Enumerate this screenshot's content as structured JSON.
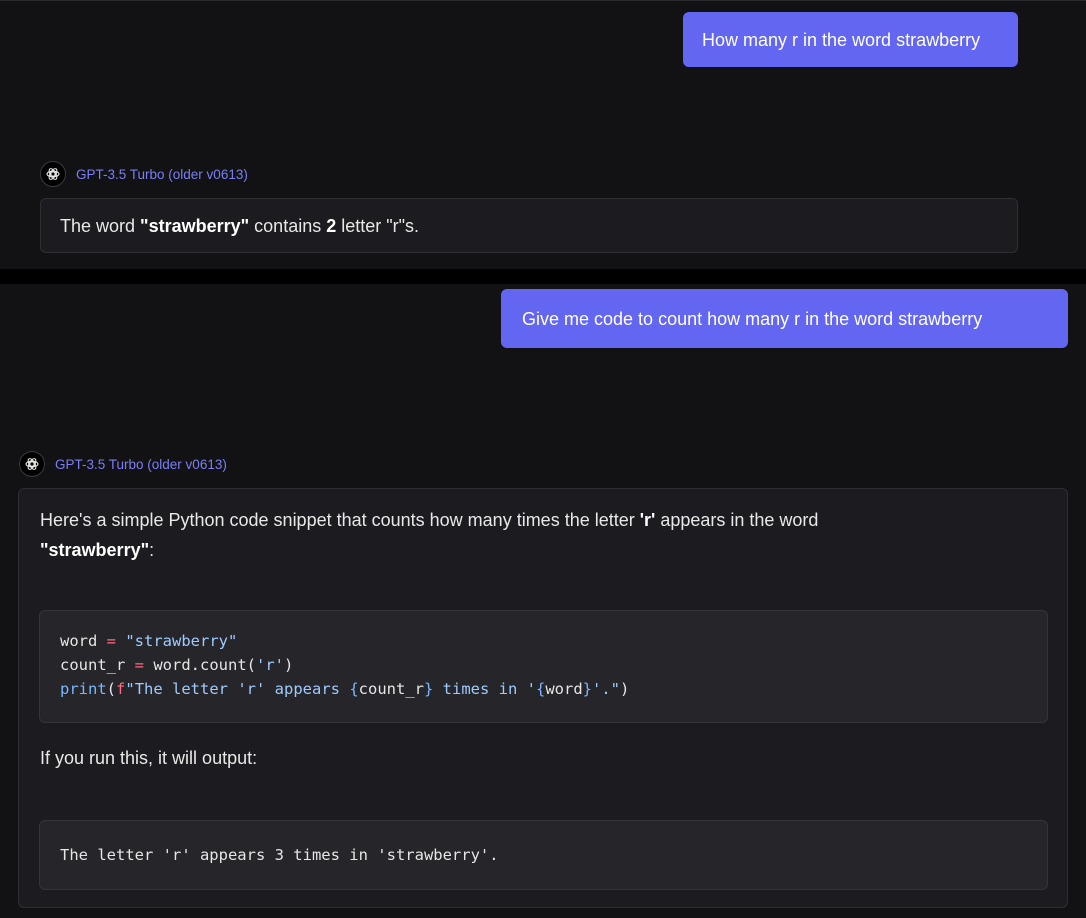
{
  "conversation_1": {
    "user_message": "How many r in the word strawberry",
    "model_name": "GPT-3.5 Turbo (older v0613)",
    "model_icon": "openai-logo-icon",
    "answer": {
      "part1": "The word ",
      "word": "\"strawberry\"",
      "part2": " contains ",
      "count": "2",
      "part3": " letter \"r\"s."
    }
  },
  "conversation_2": {
    "user_message": "Give me code to count how many r in the word strawberry",
    "model_name": "GPT-3.5 Turbo (older v0613)",
    "model_icon": "openai-logo-icon",
    "intro": {
      "part1": "Here's a simple Python code snippet that counts how many times the letter ",
      "letter": "'r'",
      "part2": " appears in the word",
      "word": "\"strawberry\"",
      "part3": ":"
    },
    "code": {
      "l1_var": "word",
      "l1_op": " = ",
      "l1_str": "\"strawberry\"",
      "l2_var": "count_r",
      "l2_op": " = ",
      "l2_call": "word.count(",
      "l2_str": "'r'",
      "l2_close": ")",
      "l3_fn": "print",
      "l3_open": "(",
      "l3_prefix": "f",
      "l3_str1": "\"The letter 'r' appears ",
      "l3_brace1": "{",
      "l3_expr1": "count_r",
      "l3_brace2": "}",
      "l3_str2": " times in '",
      "l3_brace3": "{",
      "l3_expr2": "word",
      "l3_brace4": "}",
      "l3_str3": "'.\"",
      "l3_close": ")"
    },
    "run_text": "If you run this, it will output:",
    "output": "The letter 'r' appears 3 times in 'strawberry'."
  },
  "colors": {
    "user_bubble": "#6266f1",
    "model_name": "#7b7ef5",
    "background": "#121215"
  }
}
